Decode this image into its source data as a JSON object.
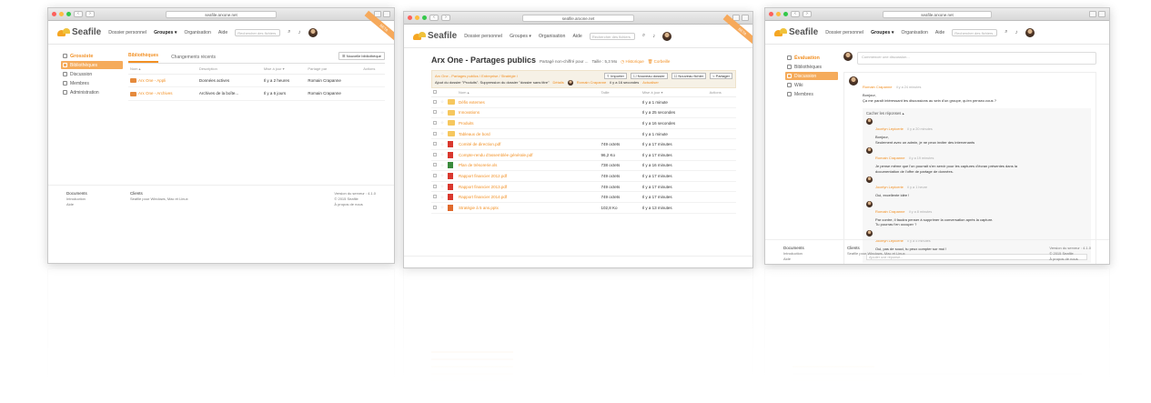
{
  "browser": {
    "url": "seafile.arxone.net"
  },
  "brand": {
    "logo_text": "Seafile",
    "superscript": "™",
    "accent": "#f29024",
    "sidebar_active": "#f5ab5b",
    "ribbon_text": "BETA"
  },
  "nav": {
    "personal": "Dossier personnel",
    "groups": "Groupes ▾",
    "org": "Organisation",
    "help": "Aide",
    "search_placeholder": "Rechercher des fichiers",
    "search_icon": "search-icon",
    "notif_icon": "bell-icon"
  },
  "left": {
    "sidebar": [
      {
        "label": "Grossiste",
        "kind": "heading",
        "icon": "group-icon"
      },
      {
        "label": "Bibliothèques",
        "kind": "active",
        "icon": "library-icon"
      },
      {
        "label": "Discussion",
        "kind": "normal",
        "icon": "chat-icon"
      },
      {
        "label": "Membres",
        "kind": "normal",
        "icon": "user-icon"
      },
      {
        "label": "Administration",
        "kind": "normal",
        "icon": "wrench-icon"
      }
    ],
    "tabs": {
      "libraries": "Bibliothèques",
      "changes": "Changements récents",
      "new_lib": "☰ Nouvelle bibliothèque"
    },
    "columns": {
      "name": "Nom ▴",
      "description": "Description",
      "modified": "Mise à jour ▾",
      "shared_by": "Partagé par",
      "actions": "Actions"
    },
    "rows": [
      {
        "name": "Arx One - Appli",
        "description": "Données actives",
        "modified": "Il y a 2 heures",
        "shared_by": "Romain Crapanne"
      },
      {
        "name": "Arx One - Archives",
        "description": "Archives de la boîte...",
        "modified": "Il y a 6 jours",
        "shared_by": "Romain Crapanne"
      }
    ],
    "footer": {
      "docs_title": "Documents",
      "docs_line1": "Introduction",
      "docs_line2": "Aide",
      "clients_title": "Clients",
      "clients_line1": "Seafile pour Windows, Mac et Linux",
      "server_line1": "Version du serveur : 4.1.0",
      "server_line2": "© 2015 Seafile",
      "server_line3": "À propos de nous"
    }
  },
  "center": {
    "title": "Arx One - Partages publics",
    "subtitle": "Partagé non-chiffré pour ...",
    "size": "Taille : 5,3 Mo",
    "history": "◷ Historique",
    "trash": "🗑 Corbeille",
    "breadcrumb": "Arx One - Partages publics / Entreprise / Stratégie /",
    "toolbar": {
      "import": "⇪ Importer",
      "new_folder": "☐ Nouveau dossier",
      "new_file": "☐ Nouveau fichier",
      "share": "< Partager"
    },
    "activity": "Ajout du dossier \"Produits\". Suppression du dossier \"dossier sans titre\"",
    "details": "Détails",
    "activity_by": "Romain Crapanne",
    "activity_when": "il y a 16 secondes",
    "refresh": "Actualiser",
    "columns": {
      "name": "Nom ▴",
      "size": "Taille",
      "modified": "Mise à jour ▾",
      "actions": "Actions"
    },
    "files": [
      {
        "type": "folder",
        "name": "Défis externes",
        "size": "",
        "modified": "Il y a 1 minute"
      },
      {
        "type": "folder",
        "name": "Innovations",
        "size": "",
        "modified": "Il y a 25 secondes"
      },
      {
        "type": "folder",
        "name": "Produits",
        "size": "",
        "modified": "Il y a 16 secondes"
      },
      {
        "type": "folder",
        "name": "Tableaux de bord",
        "size": "",
        "modified": "Il y a 1 minute"
      },
      {
        "type": "pdf",
        "name": "Comité de direction.pdf",
        "size": "749 octets",
        "modified": "Il y a 17 minutes"
      },
      {
        "type": "pdf",
        "name": "Compte-rendu d'assemblée générale.pdf",
        "size": "96,2 Ko",
        "modified": "Il y a 17 minutes"
      },
      {
        "type": "xls",
        "name": "Plan de trésorerie.xls",
        "size": "738 octets",
        "modified": "Il y a 16 minutes"
      },
      {
        "type": "pdf",
        "name": "Rapport financier 2012.pdf",
        "size": "749 octets",
        "modified": "Il y a 17 minutes"
      },
      {
        "type": "pdf",
        "name": "Rapport financier 2013.pdf",
        "size": "749 octets",
        "modified": "Il y a 17 minutes"
      },
      {
        "type": "pdf",
        "name": "Rapport financier 2014.pdf",
        "size": "749 octets",
        "modified": "Il y a 17 minutes"
      },
      {
        "type": "ppt",
        "name": "Stratégie à 5 ans.pptx",
        "size": "102,8 Ko",
        "modified": "Il y a 13 minutes"
      }
    ]
  },
  "right": {
    "sidebar": [
      {
        "label": "Évaluation",
        "kind": "heading",
        "icon": "group-icon"
      },
      {
        "label": "Bibliothèques",
        "kind": "normal",
        "icon": "library-icon"
      },
      {
        "label": "Discussion",
        "kind": "active",
        "icon": "chat-icon"
      },
      {
        "label": "Wiki",
        "kind": "normal",
        "icon": "wiki-icon"
      },
      {
        "label": "Membres",
        "kind": "normal",
        "icon": "user-icon"
      }
    ],
    "compose_placeholder": "Commencer une discussion...",
    "thread": {
      "author": "Romain Crapanne",
      "time": "il y a 24 minutes",
      "line1": "Bonjour,",
      "line2": "Ça me paraît intéressant les discussions au sein d'un groupe, qu'en pensez-vous ?",
      "replies_heading": "Cacher les réponses ▴",
      "replies": [
        {
          "author": "Jocelyn Lepicerie",
          "time": "il y a 20 minutes",
          "text1": "Bonjour,",
          "text2": "Seulement avec un admin, je ne peux inviter des intervenants"
        },
        {
          "author": "Romain Crapanne",
          "time": "il y a 19 minutes",
          "text1": "Je pense même que l'on pourrait s'en servir pour les captures d'écran présentes dans la",
          "text2": "documentation de l'offre de partage de données."
        },
        {
          "author": "Jocelyn Lepicerie",
          "time": "il y a 1 heure",
          "text1": "Oui, excellente idée !",
          "text2": ""
        },
        {
          "author": "Romain Crapanne",
          "time": "il y a 8 minutes",
          "text1": "Par contre, il faudra penser à supprimer la conversation après la capture.",
          "text2": "Tu pourras t'en occuper ?"
        },
        {
          "author": "Jocelyn Lepicerie",
          "time": "il y a 5 minutes",
          "text1": "Oui, pas de souci, tu peux compter sur moi !",
          "text2": ""
        }
      ],
      "reply_placeholder": "Ajouter une réponse..."
    }
  }
}
